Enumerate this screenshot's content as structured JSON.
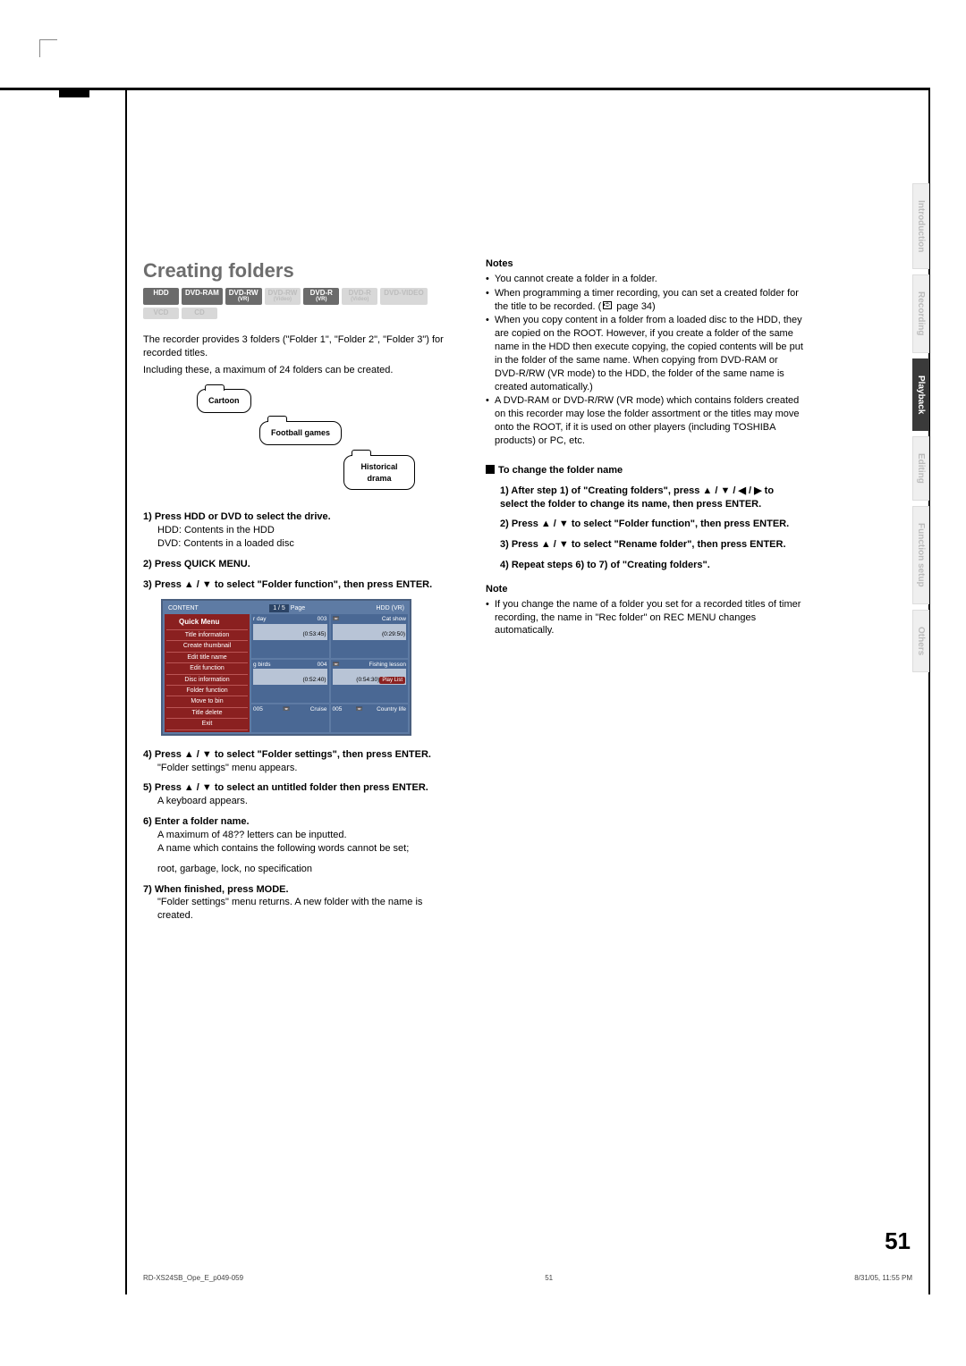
{
  "section_title": "Creating folders",
  "disc_tags": [
    {
      "label": "HDD",
      "sub": "",
      "on": true
    },
    {
      "label": "DVD-RAM",
      "sub": "",
      "on": true
    },
    {
      "label": "DVD-RW",
      "sub": "(VR)",
      "on": true
    },
    {
      "label": "DVD-RW",
      "sub": "(Video)",
      "on": false
    },
    {
      "label": "DVD-R",
      "sub": "(VR)",
      "on": true
    },
    {
      "label": "DVD-R",
      "sub": "(Video)",
      "on": false
    },
    {
      "label": "DVD-VIDEO",
      "sub": "",
      "on": false
    },
    {
      "label": "VCD",
      "sub": "",
      "on": false
    },
    {
      "label": "CD",
      "sub": "",
      "on": false
    }
  ],
  "intro1": "The recorder provides 3 folders (\"Folder 1\", \"Folder 2\", \"Folder 3\") for recorded titles.",
  "intro2": "Including these, a maximum of 24 folders can be created.",
  "folder_labels": {
    "cartoon": "Cartoon",
    "football": "Football games",
    "historical": "Historical drama"
  },
  "step1h": "1) Press HDD or DVD to select the drive.",
  "step1a": "HDD: Contents in the HDD",
  "step1b": "DVD: Contents in a loaded disc",
  "step2h": "2) Press QUICK MENU.",
  "step3h": "3) Press ▲ / ▼ to select \"Folder function\", then press ENTER.",
  "osd": {
    "content": "CONTENT",
    "page": "Page",
    "page_num": "1 / 5",
    "mode": "HDD (VR)",
    "quick_head": "Quick Menu",
    "items": [
      "Title information",
      "Create thumbnail",
      "Edit title name",
      "Edit function",
      "Disc information",
      "Folder function",
      "Move to bin",
      "Title delete",
      "Exit"
    ],
    "tiles": [
      {
        "head1": "r day",
        "head2": "003",
        "time": "(0:53:45)"
      },
      {
        "head1": "",
        "head2": "",
        "name": "Cat show",
        "time": "(0:29:50)"
      },
      {
        "head1": "g birds",
        "head2": "004",
        "time": "(0:52:40)"
      },
      {
        "head1": "",
        "head2": "",
        "name": "Fishing lesson",
        "time": "(0:54:30)",
        "play": "Play List"
      },
      {
        "head1": "005",
        "head2": "",
        "name": "Cruise",
        "time": ""
      },
      {
        "head1": "005",
        "head2": "",
        "name": "Country life",
        "time": ""
      }
    ]
  },
  "step4h": "4) Press ▲ / ▼ to select \"Folder settings\", then press ENTER.",
  "step4a": "\"Folder settings\" menu appears.",
  "step5h": "5) Press ▲ / ▼ to select an untitled folder then press ENTER.",
  "step5a": "A  keyboard appears.",
  "step6h": "6) Enter a folder name.",
  "step6a": "A maximum of 48?? letters can be inputted.",
  "step6b": "A name which contains the following words cannot be set;",
  "step6c": "root, garbage, lock, no specification",
  "step7h": "7) When finished, press MODE.",
  "step7a": "\"Folder settings\" menu returns. A new folder with the name is created.",
  "notes_h": "Notes",
  "notes": [
    "You cannot create a folder in a folder.",
    "When programming a timer recording, you can set a created folder for the title to be recorded. (       page 34)",
    "When you copy content in a folder from a loaded disc to the HDD, they are copied on the ROOT. However, if you create a folder of the same name in the HDD then execute copying, the copied contents will be put in the folder of the same name. When copying from DVD-RAM or DVD-R/RW (VR mode) to the HDD, the folder of the same name is created automatically.)",
    "A DVD-RAM or DVD-R/RW (VR mode) which contains folders created on this recorder may lose the folder assortment or the titles may move onto the ROOT, if it is used on other players (including TOSHIBA products) or PC, etc."
  ],
  "sub_h": "To change the folder name",
  "sub_steps": [
    "1) After step 1) of \"Creating folders\", press ▲ / ▼ / ◀ / ▶ to select the folder to change its name, then press ENTER.",
    "2) Press ▲ / ▼ to select \"Folder function\", then press ENTER.",
    "3) Press ▲ / ▼ to select \"Rename folder\", then press ENTER.",
    "4) Repeat steps 6) to 7) of \"Creating folders\"."
  ],
  "note2_h": "Note",
  "note2": "If you change the name of a folder you set for a recorded titles of timer recording, the name in \"Rec folder\" on REC MENU changes automatically.",
  "tabs": [
    {
      "label": "Introduction",
      "active": false
    },
    {
      "label": "Recording",
      "active": false
    },
    {
      "label": "Playback",
      "active": true
    },
    {
      "label": "Editing",
      "active": false
    },
    {
      "label": "Function setup",
      "active": false
    },
    {
      "label": "Others",
      "active": false
    }
  ],
  "page_number": "51",
  "footer": {
    "left": "RD-XS24SB_Ope_E_p049-059",
    "mid": "51",
    "right": "8/31/05, 11:55 PM"
  }
}
